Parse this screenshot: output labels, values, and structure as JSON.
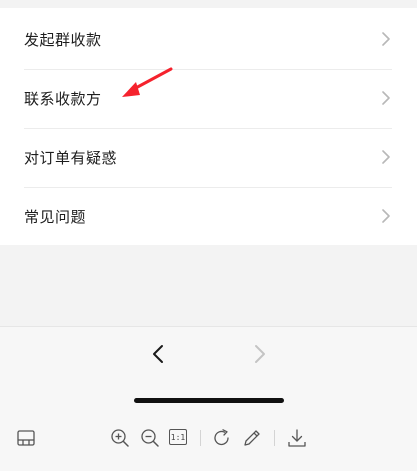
{
  "menu": {
    "items": [
      {
        "label": "发起群收款",
        "icon": "chevron-right-icon"
      },
      {
        "label": "联系收款方",
        "icon": "chevron-right-icon"
      },
      {
        "label": "对订单有疑惑",
        "icon": "chevron-right-icon"
      },
      {
        "label": "常见问题",
        "icon": "chevron-right-icon"
      }
    ]
  },
  "annotation": {
    "icon": "red-arrow-annotation-icon",
    "color": "#f5222d"
  },
  "navigation": {
    "back_icon": "chevron-left-icon",
    "forward_icon": "chevron-right-icon",
    "forward_disabled": true
  },
  "toolbar": {
    "sidebar_icon": "sidebar-toggle-icon",
    "zoom_in_icon": "zoom-in-icon",
    "zoom_out_icon": "zoom-out-icon",
    "actual_size_label": "1:1",
    "rotate_icon": "rotate-icon",
    "edit_icon": "pencil-icon",
    "download_icon": "download-icon"
  },
  "colors": {
    "background": "#ffffff",
    "panel": "#f3f3f3",
    "divider": "#ececec",
    "chevron": "#b8b8b8",
    "annotation": "#f5222d",
    "home_indicator": "#111111"
  }
}
